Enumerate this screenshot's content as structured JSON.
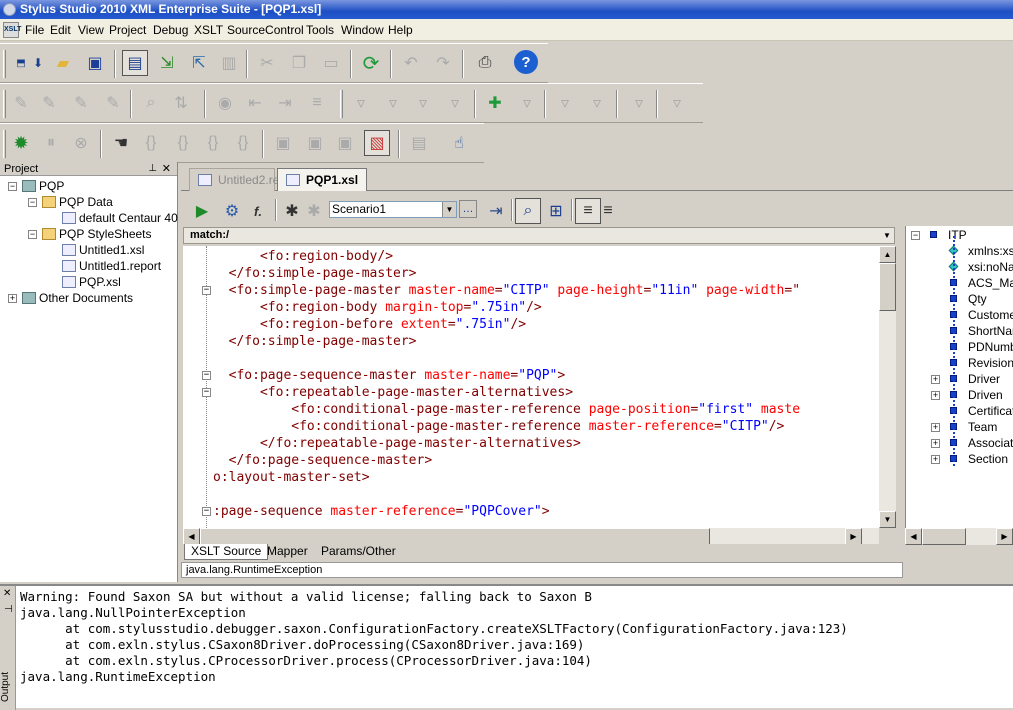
{
  "window": {
    "title": "Stylus Studio 2010 XML Enterprise Suite - [PQP1.xsl]"
  },
  "menu": [
    "File",
    "Edit",
    "View",
    "Project",
    "Debug",
    "XSLT",
    "SourceControl",
    "Tools",
    "Window",
    "Help"
  ],
  "project_panel": {
    "title": "Project",
    "tree": [
      {
        "label": "PQP",
        "level": 0,
        "icon": "project-icon",
        "expander": "−"
      },
      {
        "label": "PQP Data",
        "level": 1,
        "icon": "folder-icon",
        "expander": "−"
      },
      {
        "label": "default Centaur 40",
        "level": 2,
        "icon": "xml-file-icon",
        "expander": ""
      },
      {
        "label": "PQP StyleSheets",
        "level": 1,
        "icon": "folder-icon",
        "expander": "−"
      },
      {
        "label": "Untitled1.xsl",
        "level": 2,
        "icon": "xsl-file-icon",
        "expander": ""
      },
      {
        "label": "Untitled1.report",
        "level": 2,
        "icon": "report-file-icon",
        "expander": ""
      },
      {
        "label": "PQP.xsl",
        "level": 2,
        "icon": "xsl-file-icon",
        "expander": ""
      },
      {
        "label": "Other Documents",
        "level": 0,
        "icon": "documents-icon",
        "expander": "+"
      }
    ]
  },
  "doc_tabs": [
    {
      "label": "Untitled2.re...",
      "active": false
    },
    {
      "label": "PQP1.xsl",
      "active": true
    }
  ],
  "editor_toolbar": {
    "scenario": "Scenario1"
  },
  "match_bar": "match:/",
  "code_lines": [
    {
      "indent": "      ",
      "fold": "",
      "parts": [
        [
          "tag",
          "<fo:region-body/>"
        ]
      ]
    },
    {
      "indent": "  ",
      "fold": "",
      "parts": [
        [
          "tag",
          "</fo:simple-page-master>"
        ]
      ]
    },
    {
      "indent": "  ",
      "fold": "−",
      "parts": [
        [
          "tag",
          "<fo:simple-page-master "
        ],
        [
          "attr",
          "master-name"
        ],
        [
          "tag",
          "="
        ],
        [
          "val",
          "\"CITP\""
        ],
        [
          "tag",
          " "
        ],
        [
          "attr",
          "page-height"
        ],
        [
          "tag",
          "="
        ],
        [
          "val",
          "\"11in\""
        ],
        [
          "tag",
          " "
        ],
        [
          "attr",
          "page-width"
        ],
        [
          "tag",
          "=\""
        ]
      ]
    },
    {
      "indent": "      ",
      "fold": "",
      "parts": [
        [
          "tag",
          "<fo:region-body "
        ],
        [
          "attr",
          "margin-top"
        ],
        [
          "tag",
          "="
        ],
        [
          "val",
          "\".75in\""
        ],
        [
          "tag",
          "/>"
        ]
      ]
    },
    {
      "indent": "      ",
      "fold": "",
      "parts": [
        [
          "tag",
          "<fo:region-before "
        ],
        [
          "attr",
          "extent"
        ],
        [
          "tag",
          "="
        ],
        [
          "val",
          "\".75in\""
        ],
        [
          "tag",
          "/>"
        ]
      ]
    },
    {
      "indent": "  ",
      "fold": "",
      "parts": [
        [
          "tag",
          "</fo:simple-page-master>"
        ]
      ]
    },
    {
      "indent": "",
      "fold": "",
      "parts": []
    },
    {
      "indent": "  ",
      "fold": "−",
      "parts": [
        [
          "tag",
          "<fo:page-sequence-master "
        ],
        [
          "attr",
          "master-name"
        ],
        [
          "tag",
          "="
        ],
        [
          "val",
          "\"PQP\""
        ],
        [
          "tag",
          ">"
        ]
      ]
    },
    {
      "indent": "      ",
      "fold": "−",
      "parts": [
        [
          "tag",
          "<fo:repeatable-page-master-alternatives>"
        ]
      ]
    },
    {
      "indent": "          ",
      "fold": "",
      "parts": [
        [
          "tag",
          "<fo:conditional-page-master-reference "
        ],
        [
          "attr",
          "page-position"
        ],
        [
          "tag",
          "="
        ],
        [
          "val",
          "\"first\""
        ],
        [
          "tag",
          " "
        ],
        [
          "attr",
          "maste"
        ]
      ]
    },
    {
      "indent": "          ",
      "fold": "",
      "parts": [
        [
          "tag",
          "<fo:conditional-page-master-reference "
        ],
        [
          "attr",
          "master-reference"
        ],
        [
          "tag",
          "="
        ],
        [
          "val",
          "\"CITP\""
        ],
        [
          "tag",
          "/>"
        ]
      ]
    },
    {
      "indent": "      ",
      "fold": "",
      "parts": [
        [
          "tag",
          "</fo:repeatable-page-master-alternatives>"
        ]
      ]
    },
    {
      "indent": "  ",
      "fold": "",
      "parts": [
        [
          "tag",
          "</fo:page-sequence-master>"
        ]
      ]
    },
    {
      "indent": "",
      "fold": "",
      "parts": [
        [
          "tag",
          "o:layout-master-set>"
        ]
      ]
    },
    {
      "indent": "",
      "fold": "",
      "parts": []
    },
    {
      "indent": "",
      "fold": "−",
      "parts": [
        [
          "tag",
          ":page-sequence "
        ],
        [
          "attr",
          "master-reference"
        ],
        [
          "tag",
          "="
        ],
        [
          "val",
          "\"PQPCover\""
        ],
        [
          "tag",
          ">"
        ]
      ]
    }
  ],
  "bottom_tabs": [
    "XSLT Source",
    "Mapper",
    "Params/Other"
  ],
  "status_text": "java.lang.RuntimeException",
  "right_tree": [
    {
      "label": "ITP",
      "icon": "element-icon",
      "expander": "−",
      "root": true
    },
    {
      "label": "xmlns:xsi",
      "icon": "attribute-icon",
      "expander": ""
    },
    {
      "label": "xsi:noNam",
      "icon": "attribute-icon",
      "expander": ""
    },
    {
      "label": "ACS_Mas",
      "icon": "element-icon",
      "expander": ""
    },
    {
      "label": "Qty",
      "icon": "element-icon",
      "expander": ""
    },
    {
      "label": "Customer",
      "icon": "element-icon",
      "expander": ""
    },
    {
      "label": "ShortNam",
      "icon": "element-icon",
      "expander": ""
    },
    {
      "label": "PDNumbe",
      "icon": "element-icon",
      "expander": ""
    },
    {
      "label": "Revision",
      "icon": "element-icon",
      "expander": ""
    },
    {
      "label": "Driver",
      "icon": "element-icon",
      "expander": "+"
    },
    {
      "label": "Driven",
      "icon": "element-icon",
      "expander": "+"
    },
    {
      "label": "Certificatio",
      "icon": "element-icon",
      "expander": ""
    },
    {
      "label": "Team",
      "icon": "element-icon",
      "expander": "+"
    },
    {
      "label": "Associate",
      "icon": "element-icon",
      "expander": "+"
    },
    {
      "label": "Section",
      "icon": "element-icon",
      "expander": "+"
    }
  ],
  "output": {
    "label": "Output",
    "lines": [
      "Warning: Found Saxon SA but without a valid license; falling back to Saxon B",
      "java.lang.NullPointerException",
      "\tat com.stylusstudio.debugger.saxon.ConfigurationFactory.createXSLTFactory(ConfigurationFactory.java:123)",
      "\tat com.exln.stylus.CSaxon8Driver.doProcessing(CSaxon8Driver.java:169)",
      "\tat com.exln.stylus.CProcessorDriver.process(CProcessorDriver.java:104)",
      "java.lang.RuntimeException"
    ]
  },
  "colors": {
    "tag": "#800000",
    "attr": "#ff0000",
    "val": "#0000ff",
    "title_blue": "#1d4fc4"
  }
}
